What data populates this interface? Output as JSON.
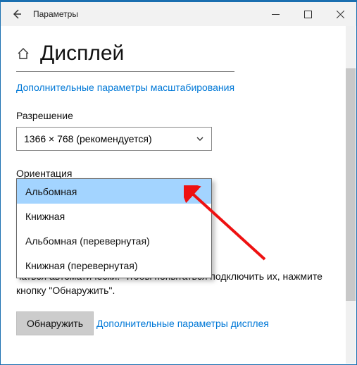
{
  "titlebar": {
    "title": "Параметры"
  },
  "header": {
    "title": "Дисплей"
  },
  "links": {
    "scale_advanced": "Дополнительные параметры масштабирования",
    "display_advanced": "Дополнительные параметры дисплея"
  },
  "resolution": {
    "label": "Разрешение",
    "value": "1366 × 768 (рекомендуется)"
  },
  "orientation": {
    "label": "Ориентация",
    "options": [
      "Альбомная",
      "Книжная",
      "Альбомная (перевернутая)",
      "Книжная (перевернутая)"
    ],
    "selected_index": 0
  },
  "detect": {
    "text_tail": "чаться автоматически. Чтобы попытаться подключить их, нажмите кнопку \"Обнаружить\".",
    "button": "Обнаружить"
  }
}
